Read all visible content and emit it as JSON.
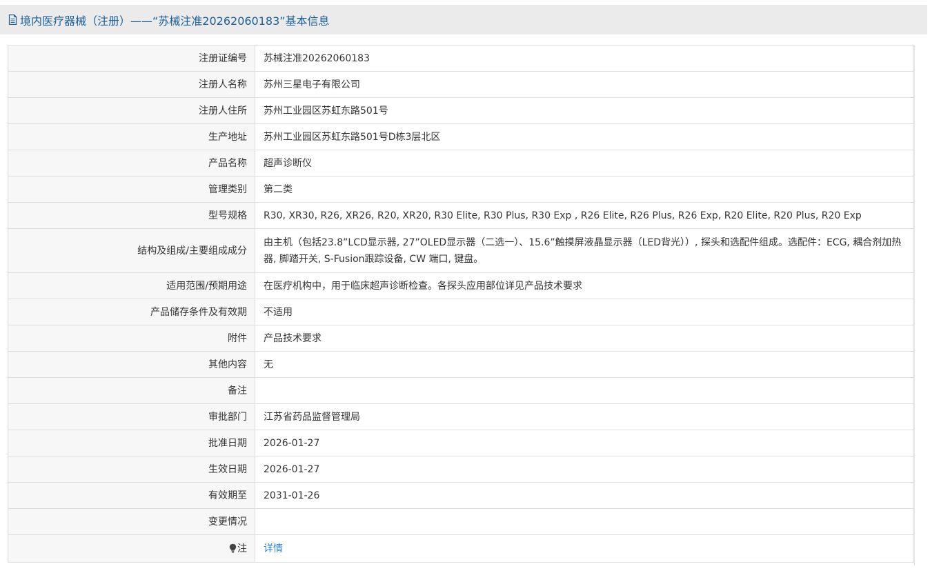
{
  "header": {
    "title": "境内医疗器械（注册）——“苏械注准20262060183”基本信息",
    "icon": "document-icon"
  },
  "rows": [
    {
      "label": "注册证编号",
      "value": "苏械注准20262060183"
    },
    {
      "label": "注册人名称",
      "value": "苏州三星电子有限公司"
    },
    {
      "label": "注册人住所",
      "value": "苏州工业园区苏虹东路501号"
    },
    {
      "label": "生产地址",
      "value": "苏州工业园区苏虹东路501号D栋3层北区"
    },
    {
      "label": "产品名称",
      "value": "超声诊断仪"
    },
    {
      "label": "管理类别",
      "value": "第二类"
    },
    {
      "label": "型号规格",
      "value": "R30, XR30, R26, XR26, R20, XR20, R30 Elite, R30 Plus, R30 Exp , R26 Elite, R26 Plus, R26 Exp, R20 Elite, R20 Plus, R20 Exp"
    },
    {
      "label": "结构及组成/主要组成成分",
      "value": "由主机（包括23.8”LCD显示器, 27”OLED显示器（二选一）、15.6”触摸屏液晶显示器（LED背光））, 探头和选配件组成。选配件：ECG, 耦合剂加热器, 脚踏开关, S-Fusion跟踪设备, CW 端口, 键盘。"
    },
    {
      "label": "适用范围/预期用途",
      "value": "在医疗机构中，用于临床超声诊断检查。各探头应用部位详见产品技术要求"
    },
    {
      "label": "产品储存条件及有效期",
      "value": "不适用"
    },
    {
      "label": "附件",
      "value": "产品技术要求"
    },
    {
      "label": "其他内容",
      "value": "无"
    },
    {
      "label": "备注",
      "value": ""
    },
    {
      "label": "审批部门",
      "value": "江苏省药品监督管理局"
    },
    {
      "label": "批准日期",
      "value": "2026-01-27"
    },
    {
      "label": "生效日期",
      "value": "2026-01-27"
    },
    {
      "label": "有效期至",
      "value": "2031-01-26"
    },
    {
      "label": "变更情况",
      "value": ""
    }
  ],
  "note_row": {
    "icon": "lightbulb-icon",
    "label": "注",
    "link_text": "详情"
  },
  "colors": {
    "title": "#1a5e9a",
    "link": "#2a7fd4",
    "label_bg": "#f7f7f7",
    "header_bg": "#ebebeb",
    "border": "#dddddd"
  }
}
